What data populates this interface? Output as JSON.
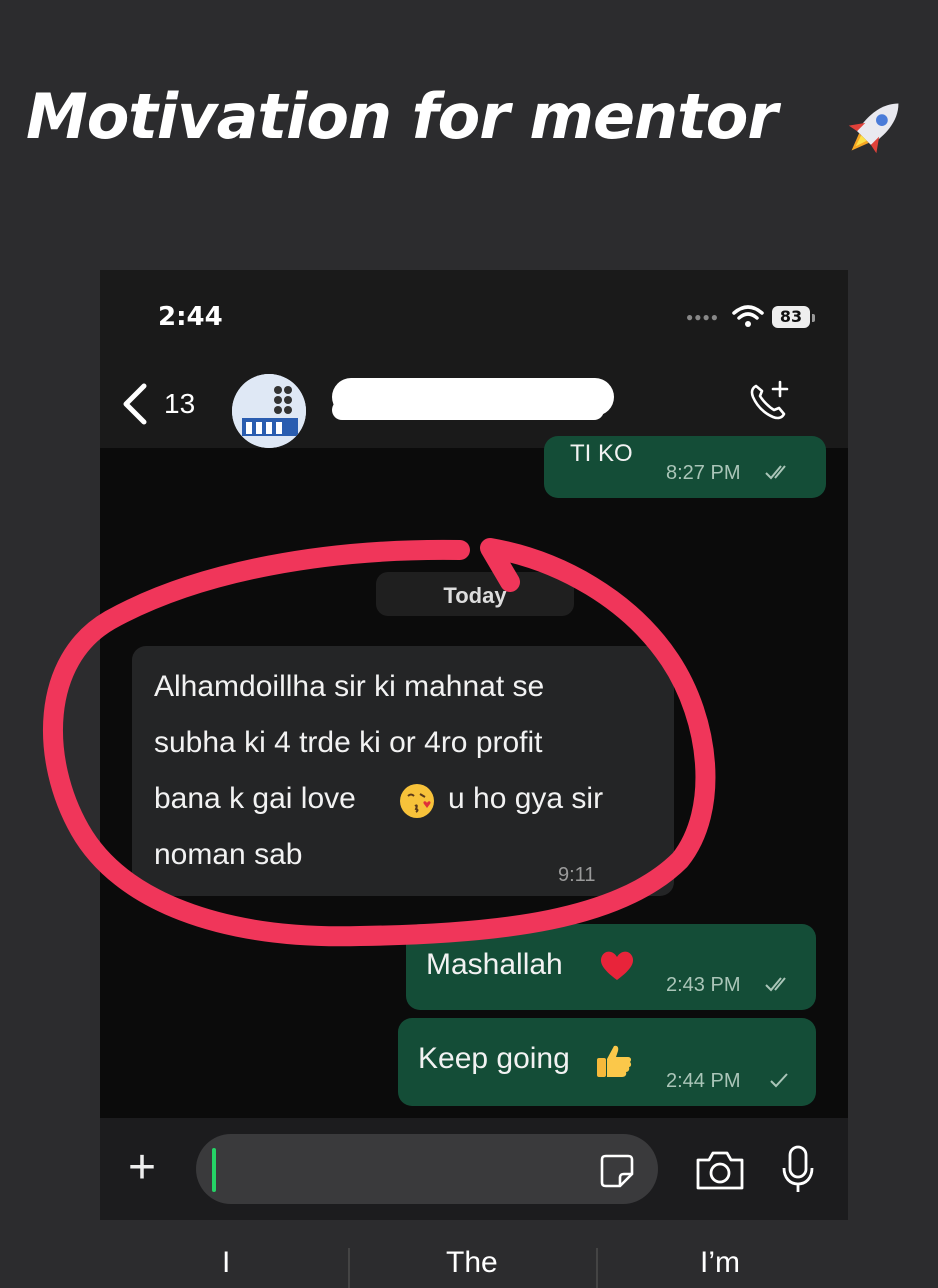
{
  "headline": {
    "text": "Motivation for mentor"
  },
  "status_bar": {
    "time": "2:44",
    "battery": "83"
  },
  "chat_header": {
    "back_count": "13"
  },
  "messages": {
    "out_prev": {
      "text": "ti ko",
      "time": "8:27 PM"
    },
    "date_divider": "Today",
    "in_1": {
      "lines": [
        "Alhamdoillha sir ki mahnat se",
        "subha ki 4 trde ki or 4ro profit",
        "bana k gai love",
        "u ho gya sir",
        "noman sab"
      ],
      "time": "9:11"
    },
    "out_1": {
      "text": "Mashallah",
      "time": "2:43 PM"
    },
    "out_2": {
      "text": "Keep going",
      "time": "2:44 PM"
    }
  },
  "composer": {
    "placeholder": ""
  },
  "keyboard_suggestions": [
    "I",
    "The",
    "I’m"
  ],
  "colors": {
    "outgoing_bubble": "#144d37",
    "incoming_bubble": "#242526",
    "annotation": "#f0365a"
  },
  "icons": [
    "rocket-icon",
    "wifi-icon",
    "back-chevron-icon",
    "avatar-image",
    "add-call-icon",
    "plus-icon",
    "sticker-icon",
    "camera-icon",
    "mic-icon",
    "double-check-icon",
    "single-check-icon",
    "kissing-face-emoji",
    "heart-emoji",
    "thumbs-up-emoji"
  ]
}
